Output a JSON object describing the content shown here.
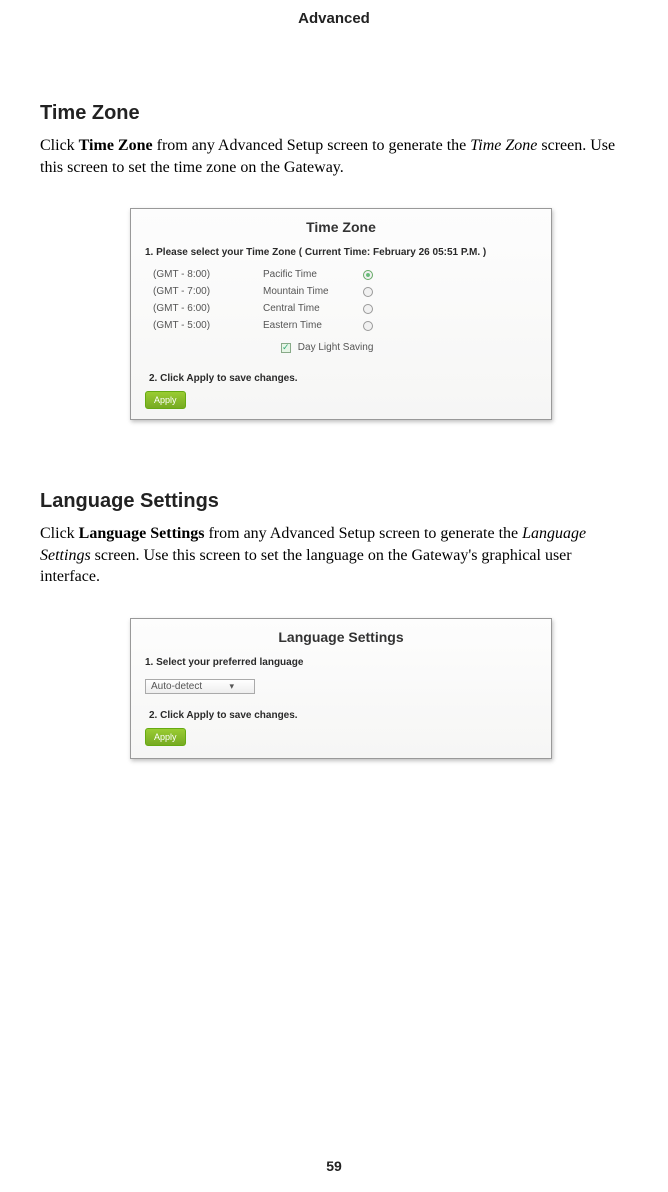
{
  "header": "Advanced",
  "page_number": "59",
  "sections": {
    "time_zone": {
      "heading": "Time Zone",
      "para_prefix": "Click ",
      "para_bold": "Time Zone",
      "para_mid1": " from any Advanced Setup screen to generate the ",
      "para_italic": "Time Zone",
      "para_mid2": " screen. Use this screen to set the time zone on the Gateway.",
      "panel_title": "Time Zone",
      "step1": "1. Please select your Time Zone   ( Current Time:  February 26 05:51 P.M. )",
      "rows": [
        {
          "gmt": "(GMT - 8:00)",
          "label": "Pacific Time",
          "selected": true
        },
        {
          "gmt": "(GMT - 7:00)",
          "label": "Mountain Time",
          "selected": false
        },
        {
          "gmt": "(GMT - 6:00)",
          "label": "Central Time",
          "selected": false
        },
        {
          "gmt": "(GMT - 5:00)",
          "label": "Eastern Time",
          "selected": false
        }
      ],
      "daylight": "Day Light Saving",
      "step2": "2. Click Apply to save changes.",
      "apply": "Apply"
    },
    "language": {
      "heading": "Language Settings",
      "para_prefix": "Click ",
      "para_bold": "Language Settings",
      "para_mid1": " from any Advanced Setup screen to generate the ",
      "para_italic": "Language Settings",
      "para_mid2": " screen. Use this screen to set the language on the Gateway's graphical user interface.",
      "panel_title": "Language Settings",
      "step1": "1. Select your preferred language",
      "select_value": "Auto-detect",
      "step2": "2. Click Apply to save changes.",
      "apply": "Apply"
    }
  }
}
